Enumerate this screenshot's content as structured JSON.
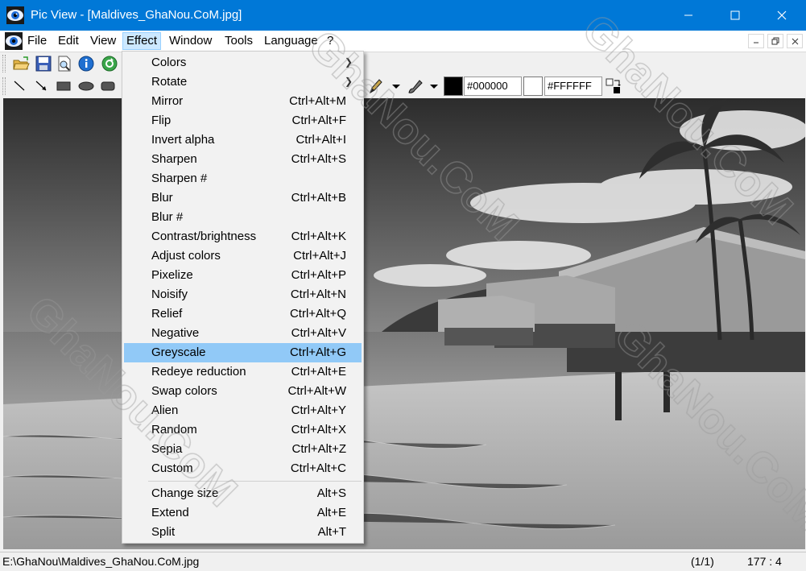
{
  "window": {
    "title": "Pic View - [Maldives_GhaNou.CoM.jpg]"
  },
  "menubar": {
    "items": [
      "File",
      "Edit",
      "View",
      "Effect",
      "Window",
      "Tools",
      "Language",
      "?"
    ],
    "active": "Effect"
  },
  "colors": {
    "foreground": "#000000",
    "background": "#FFFFFF",
    "titlebar": "#0078d7",
    "menu_highlight": "#91c9f7"
  },
  "effect_menu": {
    "items": [
      {
        "label": "Colors",
        "accel": "",
        "submenu": true
      },
      {
        "label": "Rotate",
        "accel": "",
        "submenu": true
      },
      {
        "label": "Mirror",
        "accel": "Ctrl+Alt+M"
      },
      {
        "label": "Flip",
        "accel": "Ctrl+Alt+F"
      },
      {
        "label": "Invert alpha",
        "accel": "Ctrl+Alt+I"
      },
      {
        "label": "Sharpen",
        "accel": "Ctrl+Alt+S"
      },
      {
        "label": "Sharpen #",
        "accel": ""
      },
      {
        "label": "Blur",
        "accel": "Ctrl+Alt+B"
      },
      {
        "label": "Blur #",
        "accel": ""
      },
      {
        "label": "Contrast/brightness",
        "accel": "Ctrl+Alt+K"
      },
      {
        "label": "Adjust colors",
        "accel": "Ctrl+Alt+J"
      },
      {
        "label": "Pixelize",
        "accel": "Ctrl+Alt+P"
      },
      {
        "label": "Noisify",
        "accel": "Ctrl+Alt+N"
      },
      {
        "label": "Relief",
        "accel": "Ctrl+Alt+Q"
      },
      {
        "label": "Negative",
        "accel": "Ctrl+Alt+V"
      },
      {
        "label": "Greyscale",
        "accel": "Ctrl+Alt+G",
        "highlighted": true
      },
      {
        "label": "Redeye reduction",
        "accel": "Ctrl+Alt+E"
      },
      {
        "label": "Swap colors",
        "accel": "Ctrl+Alt+W"
      },
      {
        "label": "Alien",
        "accel": "Ctrl+Alt+Y"
      },
      {
        "label": "Random",
        "accel": "Ctrl+Alt+X"
      },
      {
        "label": "Sepia",
        "accel": "Ctrl+Alt+Z"
      },
      {
        "label": "Custom",
        "accel": "Ctrl+Alt+C"
      },
      {
        "label": "Change size",
        "accel": "Alt+S"
      },
      {
        "label": "Extend",
        "accel": "Alt+E"
      },
      {
        "label": "Split",
        "accel": "Alt+T"
      }
    ]
  },
  "statusbar": {
    "path": "E:\\GhaNou\\Maldives_GhaNou.CoM.jpg",
    "page": "(1/1)",
    "position": "177 : 4"
  },
  "watermark": "GhaNou.CoM",
  "icons": {
    "toolbar1": [
      "open-folder-icon",
      "save-icon",
      "print-preview-icon",
      "info-icon",
      "refresh-icon"
    ],
    "toolbar2": [
      "line-tool-icon",
      "arrow-tool-icon",
      "rectangle-tool-icon",
      "ellipse-tool-icon",
      "rounded-rect-tool-icon",
      "pen-tool-icon",
      "brush-tool-icon",
      "swap-colors-icon"
    ]
  }
}
